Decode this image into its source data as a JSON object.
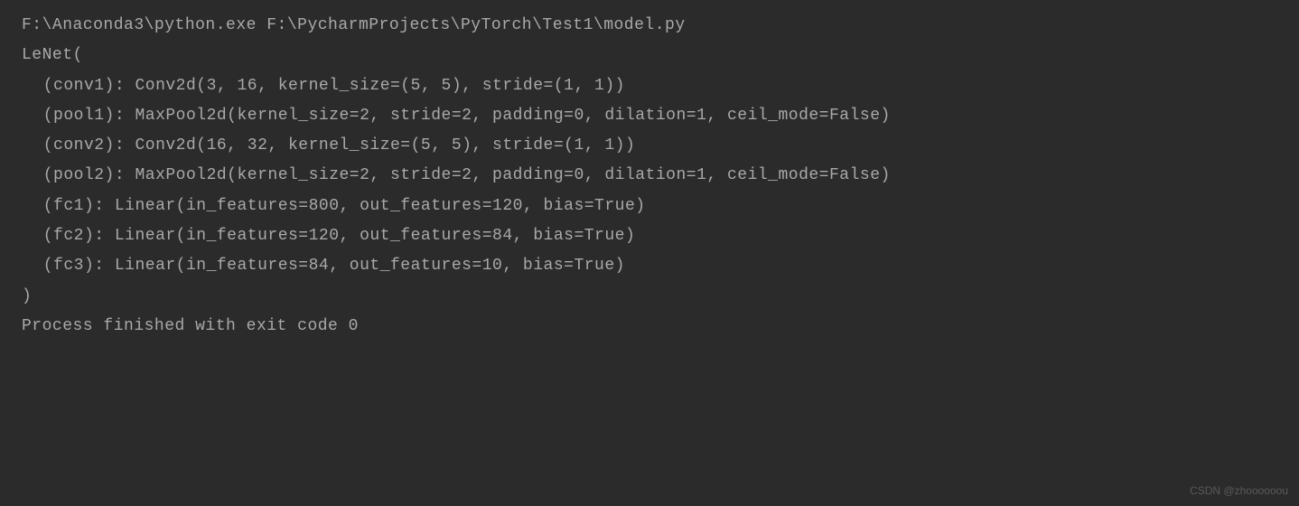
{
  "console": {
    "command": "F:\\Anaconda3\\python.exe F:\\PycharmProjects\\PyTorch\\Test1\\model.py",
    "model_header": "LeNet(",
    "layers": {
      "conv1": "(conv1): Conv2d(3, 16, kernel_size=(5, 5), stride=(1, 1))",
      "pool1": "(pool1): MaxPool2d(kernel_size=2, stride=2, padding=0, dilation=1, ceil_mode=False)",
      "conv2": "(conv2): Conv2d(16, 32, kernel_size=(5, 5), stride=(1, 1))",
      "pool2": "(pool2): MaxPool2d(kernel_size=2, stride=2, padding=0, dilation=1, ceil_mode=False)",
      "fc1": "(fc1): Linear(in_features=800, out_features=120, bias=True)",
      "fc2": "(fc2): Linear(in_features=120, out_features=84, bias=True)",
      "fc3": "(fc3): Linear(in_features=84, out_features=10, bias=True)"
    },
    "model_footer": ")",
    "blank": "",
    "exit_message": "Process finished with exit code 0"
  },
  "watermark": "CSDN @zhoooooou"
}
